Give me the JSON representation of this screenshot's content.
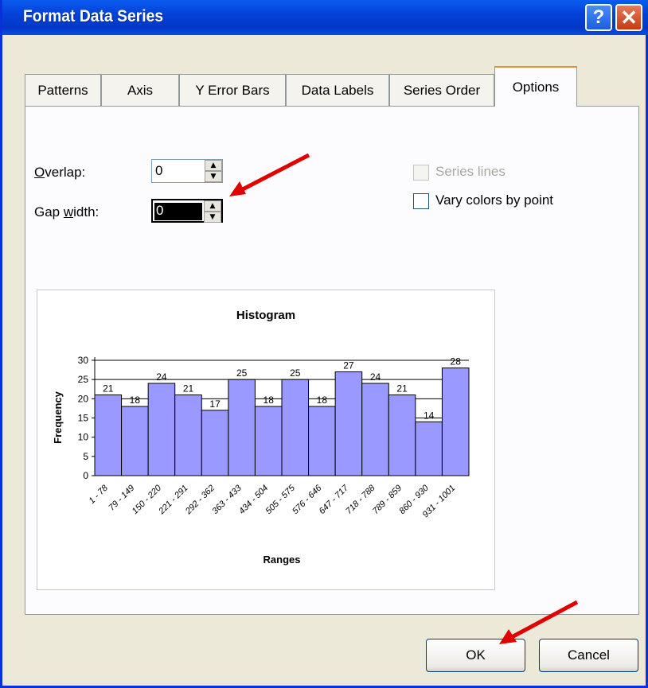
{
  "window": {
    "title": "Format Data Series"
  },
  "tabs": [
    {
      "label": "Patterns"
    },
    {
      "label": "Axis"
    },
    {
      "label": "Y Error Bars"
    },
    {
      "label": "Data Labels"
    },
    {
      "label": "Series Order"
    },
    {
      "label": "Options"
    }
  ],
  "options": {
    "overlap_label": "Overlap:",
    "overlap_value": "0",
    "gap_label": "Gap width:",
    "gap_value": "0",
    "series_lines_label": "Series lines",
    "vary_colors_label": "Vary colors by point"
  },
  "buttons": {
    "ok": "OK",
    "cancel": "Cancel"
  },
  "colors": {
    "bar_fill": "#9999ff",
    "accent_arrow": "#e00000",
    "titlebar": "#0a5cf0"
  },
  "chart_data": {
    "type": "bar",
    "title": "Histogram",
    "xlabel": "Ranges",
    "ylabel": "Frequency",
    "ylim": [
      0,
      30
    ],
    "yticks": [
      0,
      5,
      10,
      15,
      20,
      25,
      30
    ],
    "grid": true,
    "categories": [
      "1 - 78",
      "79 - 149",
      "150 - 220",
      "221 - 291",
      "292 - 362",
      "363 - 433",
      "434 - 504",
      "505 - 575",
      "576 - 646",
      "647 - 717",
      "718 - 788",
      "789 - 859",
      "860 - 930",
      "931 - 1001"
    ],
    "values": [
      21,
      18,
      24,
      21,
      17,
      25,
      18,
      25,
      18,
      27,
      24,
      21,
      14,
      28
    ]
  }
}
